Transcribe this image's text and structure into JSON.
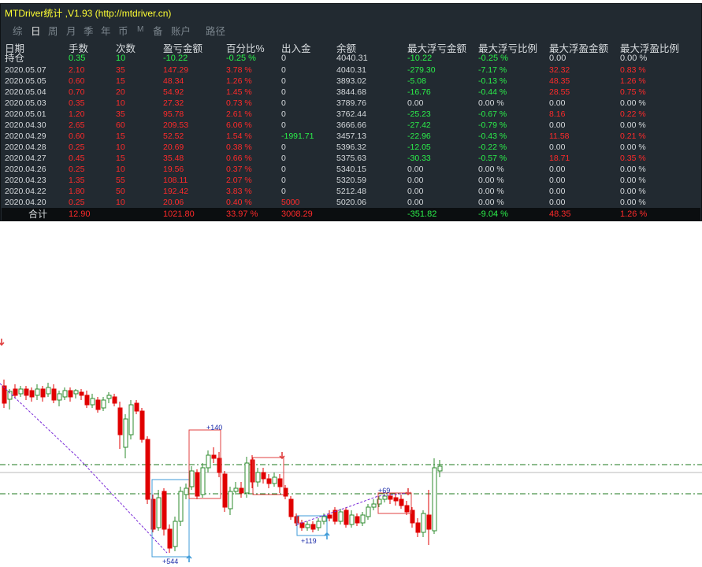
{
  "window": {
    "title": "MTDriver统计 ,V1.93 (http://mtdriver.cn)"
  },
  "tabs": [
    {
      "label": "综",
      "active": false
    },
    {
      "label": "日",
      "active": true
    },
    {
      "label": "周",
      "active": false
    },
    {
      "label": "月",
      "active": false
    },
    {
      "label": "季",
      "active": false
    },
    {
      "label": "年",
      "active": false
    },
    {
      "label": "币",
      "active": false
    },
    {
      "label": "M",
      "active": false
    },
    {
      "label": "备",
      "active": false
    },
    {
      "label": "账户",
      "active": false
    },
    {
      "label": "路径",
      "active": false
    }
  ],
  "table": {
    "headers": [
      "日期",
      "手数",
      "次数",
      "盈亏金额",
      "百分比%",
      "出入金",
      "余额",
      "最大浮亏金额",
      "最大浮亏比例",
      "最大浮盈金额",
      "最大浮盈比例"
    ],
    "holding": [
      "持仓",
      "0.35",
      "10",
      "-10.22",
      "-0.25 %",
      "0",
      "4040.31",
      "-10.22",
      "-0.25 %",
      "0.00",
      "0.00 %"
    ],
    "rows": [
      [
        "2020.05.07",
        "2.10",
        "35",
        "147.29",
        "3.78 %",
        "0",
        "4040.31",
        "-279.30",
        "-7.17 %",
        "32.32",
        "0.83 %"
      ],
      [
        "2020.05.05",
        "0.60",
        "15",
        "48.34",
        "1.26 %",
        "0",
        "3893.02",
        "-5.08",
        "-0.13 %",
        "48.35",
        "1.26 %"
      ],
      [
        "2020.05.04",
        "0.70",
        "20",
        "54.92",
        "1.45 %",
        "0",
        "3844.68",
        "-16.76",
        "-0.44 %",
        "28.55",
        "0.75 %"
      ],
      [
        "2020.05.03",
        "0.35",
        "10",
        "27.32",
        "0.73 %",
        "0",
        "3789.76",
        "0.00",
        "0.00 %",
        "0.00",
        "0.00 %"
      ],
      [
        "2020.05.01",
        "1.20",
        "35",
        "95.78",
        "2.61 %",
        "0",
        "3762.44",
        "-25.23",
        "-0.67 %",
        "8.16",
        "0.22 %"
      ],
      [
        "2020.04.30",
        "2.65",
        "60",
        "209.53",
        "6.06 %",
        "0",
        "3666.66",
        "-27.42",
        "-0.79 %",
        "0.00",
        "0.00 %"
      ],
      [
        "2020.04.29",
        "0.60",
        "15",
        "52.52",
        "1.54 %",
        "-1991.71",
        "3457.13",
        "-22.96",
        "-0.43 %",
        "11.58",
        "0.21 %"
      ],
      [
        "2020.04.28",
        "0.25",
        "10",
        "20.69",
        "0.38 %",
        "0",
        "5396.32",
        "-12.05",
        "-0.22 %",
        "0.00",
        "0.00 %"
      ],
      [
        "2020.04.27",
        "0.45",
        "15",
        "35.48",
        "0.66 %",
        "0",
        "5375.63",
        "-30.33",
        "-0.57 %",
        "18.71",
        "0.35 %"
      ],
      [
        "2020.04.26",
        "0.25",
        "10",
        "19.56",
        "0.37 %",
        "0",
        "5340.15",
        "0.00",
        "0.00 %",
        "0.00",
        "0.00 %"
      ],
      [
        "2020.04.23",
        "1.35",
        "55",
        "108.11",
        "2.07 %",
        "0",
        "5320.59",
        "0.00",
        "0.00 %",
        "0.00",
        "0.00 %"
      ],
      [
        "2020.04.22",
        "1.80",
        "50",
        "192.42",
        "3.83 %",
        "0",
        "5212.48",
        "0.00",
        "0.00 %",
        "0.00",
        "0.00 %"
      ],
      [
        "2020.04.20",
        "0.25",
        "10",
        "20.06",
        "0.40 %",
        "5000",
        "5020.06",
        "0.00",
        "0.00 %",
        "0.00",
        "0.00 %"
      ]
    ],
    "total": [
      "合计",
      "12.90",
      "",
      "1021.80",
      "33.97 %",
      "3008.29",
      "",
      "-351.82",
      "-9.04 %",
      "48.35",
      "1.26 %"
    ]
  },
  "colors": {
    "panel_bg": "#222a31",
    "title": "#ffff33",
    "positive": "#ff2a2a",
    "negative": "#2bf04a",
    "neutral": "#d5d9dc",
    "bull_candle": "#2e8b2e",
    "bear_candle": "#e00000",
    "level_line": "#1e7a1e"
  },
  "chart_annotations": {
    "labels": [
      "+140",
      "+69",
      "+119",
      "+544"
    ]
  }
}
